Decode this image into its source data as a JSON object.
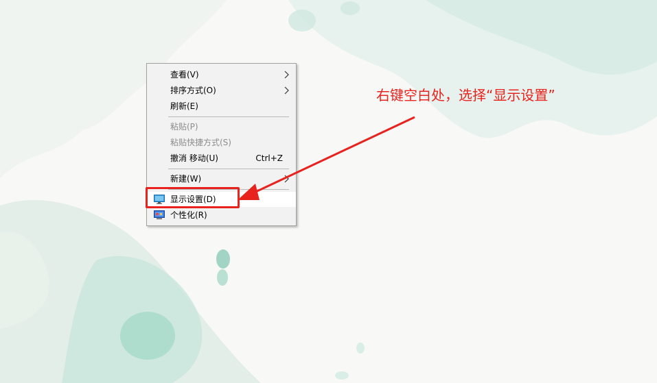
{
  "context_menu": {
    "items": [
      {
        "label": "查看(V)",
        "has_submenu": true,
        "enabled": true
      },
      {
        "label": "排序方式(O)",
        "has_submenu": true,
        "enabled": true
      },
      {
        "label": "刷新(E)",
        "enabled": true
      },
      {
        "label": "粘贴(P)",
        "enabled": false
      },
      {
        "label": "粘贴快捷方式(S)",
        "enabled": false
      },
      {
        "label": "撤消 移动(U)",
        "shortcut": "Ctrl+Z",
        "enabled": true
      },
      {
        "label": "新建(W)",
        "has_submenu": true,
        "enabled": true
      },
      {
        "label": "显示设置(D)",
        "icon": "display-settings-icon",
        "enabled": true,
        "highlighted": true
      },
      {
        "label": "个性化(R)",
        "icon": "personalize-icon",
        "enabled": true
      }
    ]
  },
  "annotation": {
    "text": "右键空白处，选择“显示设置”",
    "color": "#e8231e"
  }
}
